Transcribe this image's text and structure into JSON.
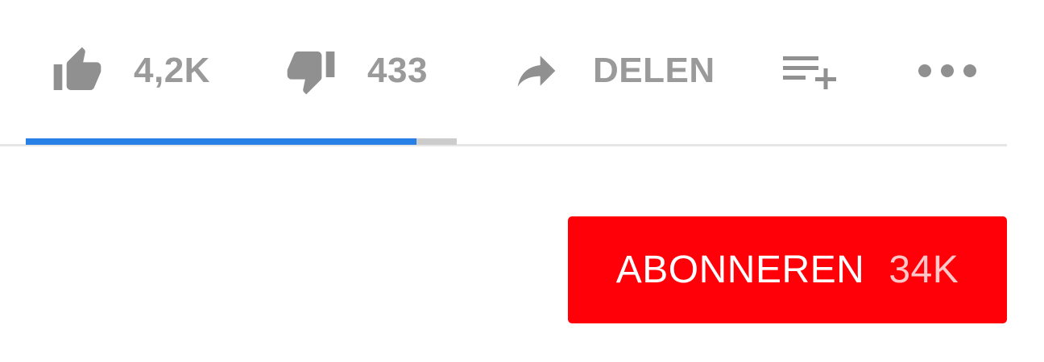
{
  "actions": {
    "like": {
      "icon": "thumbs-up-icon",
      "count": "4,2K"
    },
    "dislike": {
      "icon": "thumbs-down-icon",
      "count": "433"
    },
    "share": {
      "icon": "share-arrow-icon",
      "label": "DELEN"
    },
    "save": {
      "icon": "add-to-playlist-icon"
    },
    "more": {
      "icon": "more-horizontal-icon"
    }
  },
  "sentiment": {
    "like_ratio": 0.906,
    "like_color": "#2680e6",
    "dislike_color": "#cccccc"
  },
  "subscribe": {
    "label": "ABONNEREN",
    "count": "34K",
    "color": "#ff0008"
  }
}
